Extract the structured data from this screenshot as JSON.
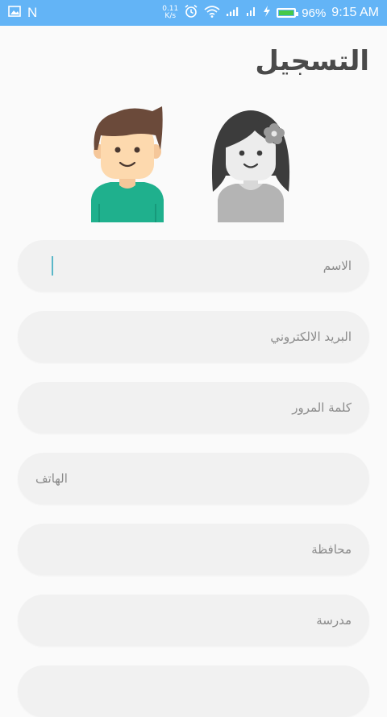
{
  "status_bar": {
    "speed_value": "0.11",
    "speed_unit": "K/s",
    "network": ".ıl",
    "battery_percent": "96%",
    "battery_level": 0.96,
    "time": "9:15 AM",
    "notification_letter": "N"
  },
  "page": {
    "title": "التسجيل"
  },
  "avatars": [
    {
      "name": "boy-avatar"
    },
    {
      "name": "girl-avatar"
    }
  ],
  "form": {
    "name_placeholder": "الاسم",
    "email_placeholder": "البريد الالكتروني",
    "password_placeholder": "كلمة المرور",
    "phone_placeholder": "الهاتف",
    "governorate_placeholder": "محافظة",
    "school_placeholder": "مدرسة",
    "last_placeholder": ""
  },
  "colors": {
    "status_bar": "#63b4f6",
    "field_bg": "#f1f1f1",
    "title": "#4a4a4a",
    "cursor": "#5ab7c8",
    "boy_shirt": "#1fb08d",
    "battery": "#46c94a"
  }
}
